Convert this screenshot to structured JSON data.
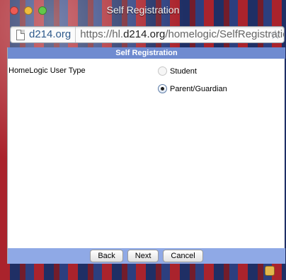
{
  "window": {
    "title": "Self Registration"
  },
  "browser": {
    "domain": "d214.org",
    "url_prefix": "https://hl.",
    "url_host": "d214.org",
    "url_path": "/homelogic/SelfRegistratic"
  },
  "form": {
    "header": "Self Registration",
    "user_type_label": "HomeLogic User Type",
    "options": [
      {
        "label": "Student",
        "checked": false,
        "disabled": true
      },
      {
        "label": "Parent/Guardian",
        "checked": true,
        "disabled": false
      }
    ]
  },
  "footer": {
    "back_label": "Back",
    "next_label": "Next",
    "cancel_label": "Cancel"
  },
  "icons": {
    "close": "close-icon",
    "minimize": "minimize-icon",
    "zoom": "zoom-icon",
    "page": "page-icon",
    "bookmark": "star-icon"
  },
  "colors": {
    "header_bar": "#6f8bd0",
    "footer_bar": "#8fa9e6",
    "traffic_red": "#ee5b55",
    "traffic_yellow": "#f2bb3b",
    "traffic_green": "#62c74a"
  }
}
